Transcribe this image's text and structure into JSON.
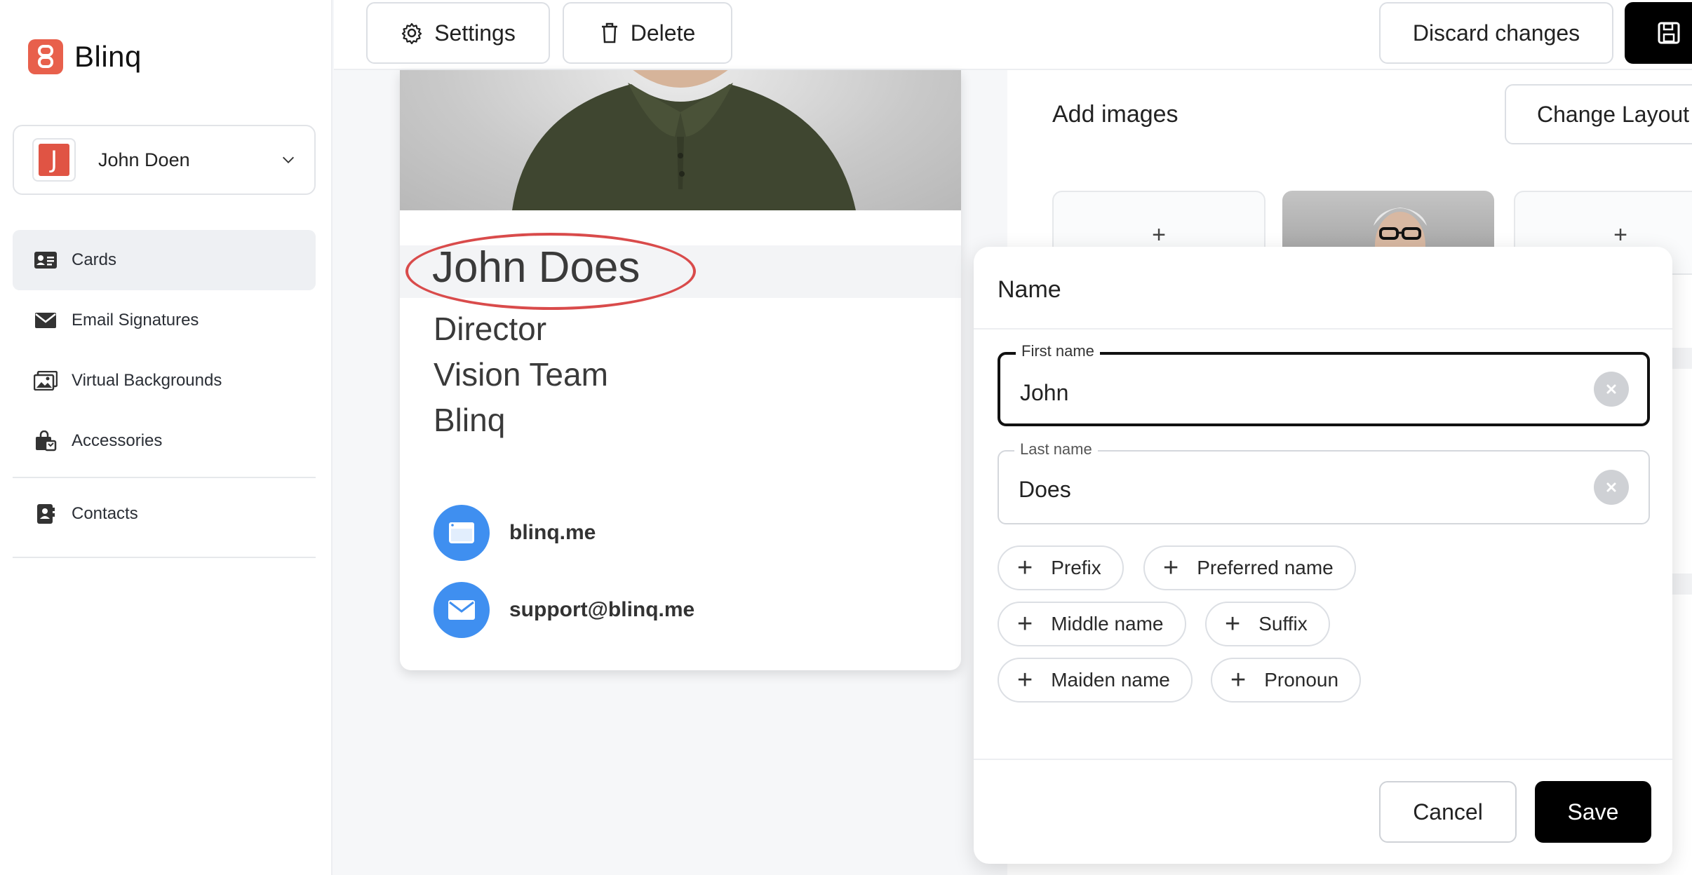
{
  "brand": {
    "name": "Blinq"
  },
  "user": {
    "name": "John Doen",
    "initial": "J"
  },
  "sidebar": {
    "items": [
      {
        "label": "Cards"
      },
      {
        "label": "Email Signatures"
      },
      {
        "label": "Virtual Backgrounds"
      },
      {
        "label": "Accessories"
      },
      {
        "label": "Contacts"
      }
    ]
  },
  "toolbar": {
    "settings_label": "Settings",
    "delete_label": "Delete",
    "discard_label": "Discard changes"
  },
  "card": {
    "name": "John Does",
    "title": "Director",
    "department": "Vision Team",
    "company": "Blinq",
    "website": "blinq.me",
    "email": "support@blinq.me"
  },
  "images_panel": {
    "heading": "Add images",
    "change_layout_label": "Change Layout",
    "add_symbol": "+"
  },
  "modal": {
    "title": "Name",
    "first_name": {
      "label": "First name",
      "value": "John"
    },
    "last_name": {
      "label": "Last name",
      "value": "Does"
    },
    "chips": [
      "Prefix",
      "Preferred name",
      "Middle name",
      "Suffix",
      "Maiden name",
      "Pronoun"
    ],
    "cancel_label": "Cancel",
    "save_label": "Save"
  },
  "colors": {
    "brand": "#e8604c",
    "contact_icon": "#3f8ff0",
    "highlight_circle": "#d94b4b",
    "primary_button": "#000000"
  }
}
